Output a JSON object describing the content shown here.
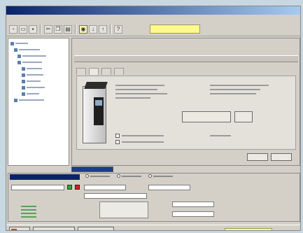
{
  "window": {
    "title": ""
  },
  "menu": {
    "items": [
      "",
      "",
      "",
      "",
      "",
      "",
      ""
    ]
  },
  "toolbar": {
    "status_field": ""
  },
  "tree": {
    "items": [
      {
        "label": "",
        "indent": 0
      },
      {
        "label": "",
        "indent": 1
      },
      {
        "label": "",
        "indent": 2
      },
      {
        "label": "",
        "indent": 2
      },
      {
        "label": "",
        "indent": 3
      },
      {
        "label": "",
        "indent": 3
      },
      {
        "label": "",
        "indent": 3
      },
      {
        "label": "",
        "indent": 3
      },
      {
        "label": "",
        "indent": 3
      },
      {
        "label": "",
        "indent": 1
      }
    ]
  },
  "main": {
    "header": "",
    "tabs": [
      "",
      "",
      "",
      ""
    ],
    "device": {
      "description": "",
      "info": "",
      "option1": "",
      "option2": "",
      "action_button": "",
      "side_button": "",
      "footer": ""
    },
    "dialog_buttons": [
      "",
      ""
    ]
  },
  "bottom": {
    "title": "",
    "modes": [
      "",
      "",
      ""
    ],
    "items": [
      "",
      "",
      "",
      ""
    ]
  },
  "taskbar": {
    "start": "",
    "tasks": [
      "",
      ""
    ],
    "status": ""
  }
}
